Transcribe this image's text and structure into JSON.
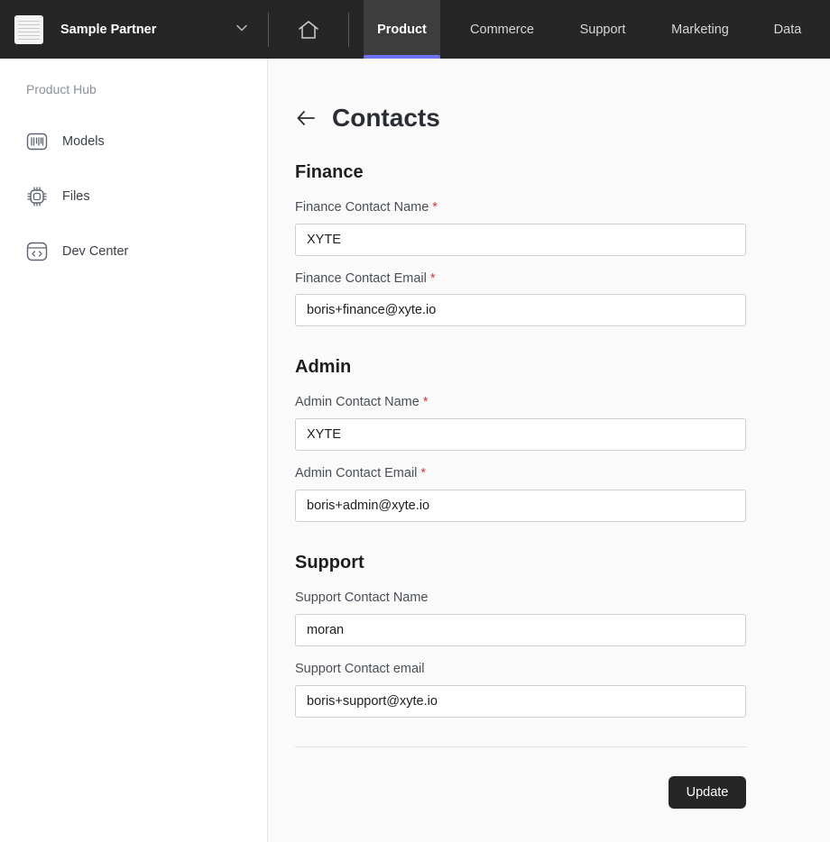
{
  "topbar": {
    "org_name": "Sample Partner",
    "tabs": [
      {
        "label": "Product",
        "active": true
      },
      {
        "label": "Commerce"
      },
      {
        "label": "Support"
      },
      {
        "label": "Marketing"
      },
      {
        "label": "Data"
      }
    ]
  },
  "sidebar": {
    "heading": "Product Hub",
    "items": [
      {
        "label": "Models",
        "icon": "barcode-icon"
      },
      {
        "label": "Files",
        "icon": "chip-icon"
      },
      {
        "label": "Dev Center",
        "icon": "code-window-icon"
      }
    ]
  },
  "page": {
    "title": "Contacts",
    "required_mark": "*",
    "sections": {
      "finance": {
        "title": "Finance",
        "name_label": "Finance Contact Name",
        "name_value": "XYTE",
        "email_label": "Finance Contact Email",
        "email_value": "boris+finance@xyte.io"
      },
      "admin": {
        "title": "Admin",
        "name_label": "Admin Contact Name",
        "name_value": "XYTE",
        "email_label": "Admin Contact Email",
        "email_value": "boris+admin@xyte.io"
      },
      "support": {
        "title": "Support",
        "name_label": "Support Contact Name",
        "name_value": "moran",
        "email_label": "Support Contact email",
        "email_value": "boris+support@xyte.io"
      }
    },
    "update_label": "Update"
  },
  "colors": {
    "topbar_bg": "#262626",
    "active_tab_bg": "#3d3d3d",
    "active_indicator": "#6b72f5",
    "required": "#d63a3a",
    "button_bg": "#262626"
  }
}
